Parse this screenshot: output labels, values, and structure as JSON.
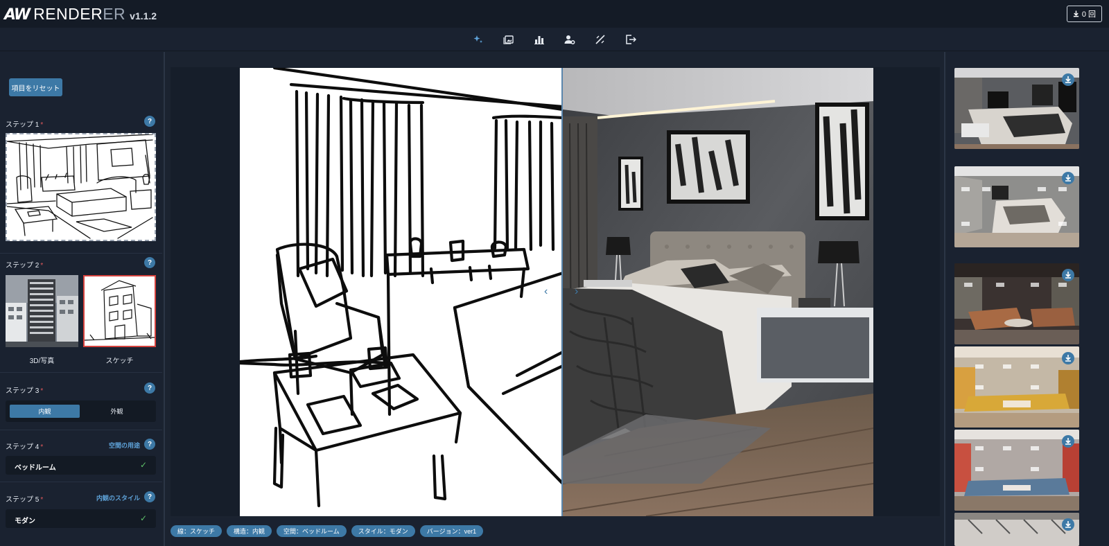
{
  "app": {
    "logo_mark": "AW",
    "name_main": "RENDER",
    "name_dim": "ER",
    "version": "v1.1.2",
    "credit_label": "0 回",
    "accent": "#3d79a6"
  },
  "toolbar": {
    "items": [
      {
        "name": "ai-generate-icon"
      },
      {
        "name": "gallery-icon"
      },
      {
        "name": "stats-icon"
      },
      {
        "name": "user-settings-icon"
      },
      {
        "name": "tools-icon"
      },
      {
        "name": "logout-icon"
      }
    ]
  },
  "left": {
    "reset_label": "項目をリセット",
    "step1": {
      "label": "ステップ 1",
      "req": "*",
      "help": "?"
    },
    "step2": {
      "label": "ステップ 2",
      "req": "*",
      "help": "?",
      "option1": "3D/写真",
      "option2": "スケッチ"
    },
    "step3": {
      "label": "ステップ 3",
      "req": "*",
      "help": "?",
      "seg_a": "内観",
      "seg_b": "外観"
    },
    "step4": {
      "label": "ステップ 4",
      "req": "*",
      "help": "?",
      "link": "空間の用途",
      "value": "ベッドルーム",
      "check": "✓"
    },
    "step5": {
      "label": "ステップ 5",
      "req": "*",
      "help": "?",
      "link": "内観のスタイル",
      "value": "モダン",
      "check": "✓"
    }
  },
  "compare": {
    "arrow_left": "‹",
    "arrow_right": "›"
  },
  "tags": [
    "線：スケッチ",
    "構造：内観",
    "空間：ベッドルーム",
    "スタイル：モダン",
    "バージョン：ver1"
  ]
}
